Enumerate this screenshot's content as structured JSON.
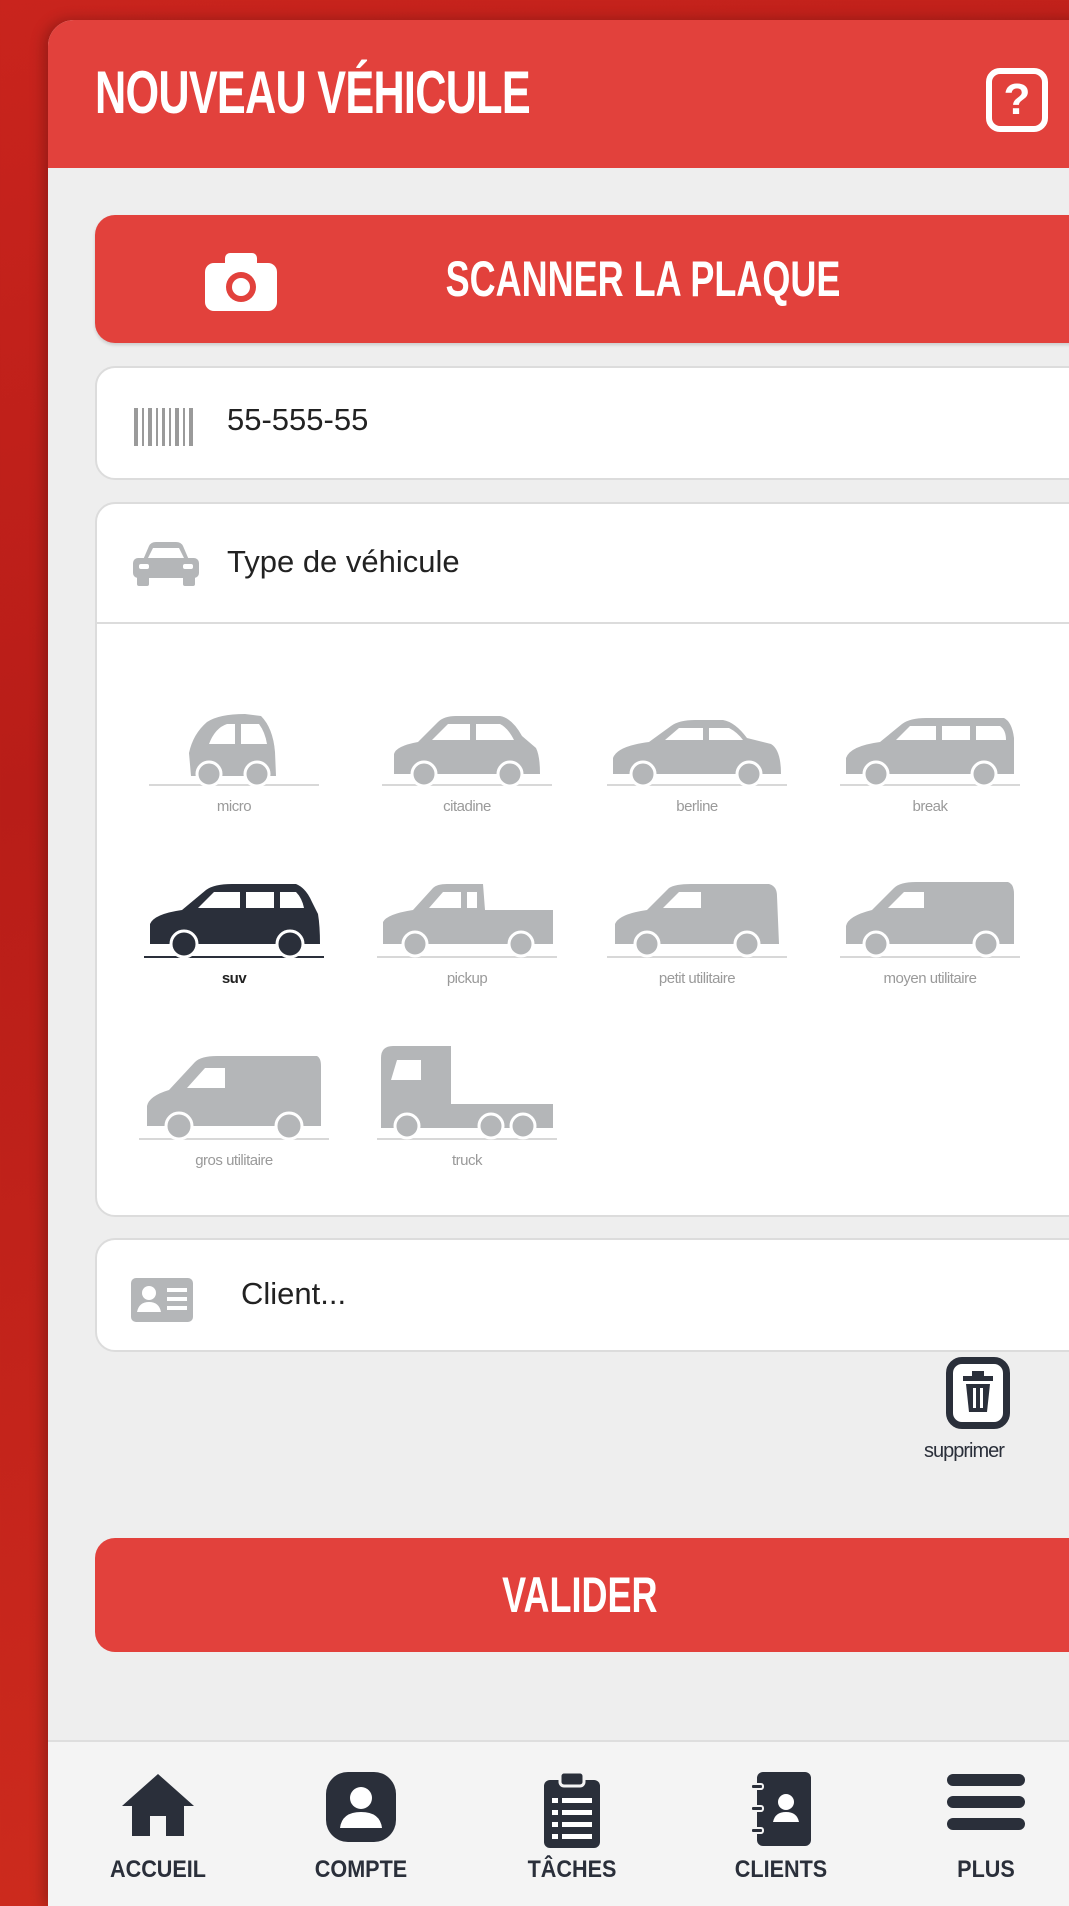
{
  "header": {
    "title": "NOUVEAU VÉHICULE",
    "help_label": "?"
  },
  "scan": {
    "label": "SCANNER LA PLAQUE",
    "icon": "camera-icon"
  },
  "plate": {
    "value": "55-555-55",
    "icon": "barcode-icon"
  },
  "vehicle_type": {
    "label": "Type de véhicule",
    "icon": "car-icon",
    "selected": "suv",
    "options": [
      {
        "id": "micro",
        "label": "micro"
      },
      {
        "id": "citadine",
        "label": "citadine"
      },
      {
        "id": "berline",
        "label": "berline"
      },
      {
        "id": "break",
        "label": "break"
      },
      {
        "id": "suv",
        "label": "suv"
      },
      {
        "id": "pickup",
        "label": "pickup"
      },
      {
        "id": "petit-utilitaire",
        "label": "petit utilitaire"
      },
      {
        "id": "moyen-utilitaire",
        "label": "moyen utilitaire"
      },
      {
        "id": "gros-utilitaire",
        "label": "gros utilitaire"
      },
      {
        "id": "truck",
        "label": "truck"
      }
    ]
  },
  "client": {
    "placeholder": "Client...",
    "icon": "id-card-icon"
  },
  "delete": {
    "label": "supprimer",
    "icon": "trash-icon"
  },
  "validate": {
    "label": "VALIDER"
  },
  "tabs": [
    {
      "label": "ACCUEIL",
      "icon": "home-icon"
    },
    {
      "label": "COMPTE",
      "icon": "user-icon"
    },
    {
      "label": "TÂCHES",
      "icon": "clipboard-list-icon"
    },
    {
      "label": "CLIENTS",
      "icon": "address-book-icon"
    },
    {
      "label": "PLUS",
      "icon": "menu-icon"
    }
  ],
  "colors": {
    "brand_red": "#e2413c",
    "dark": "#2a2f3a",
    "inactive_vehicle": "#b4b6b8"
  }
}
